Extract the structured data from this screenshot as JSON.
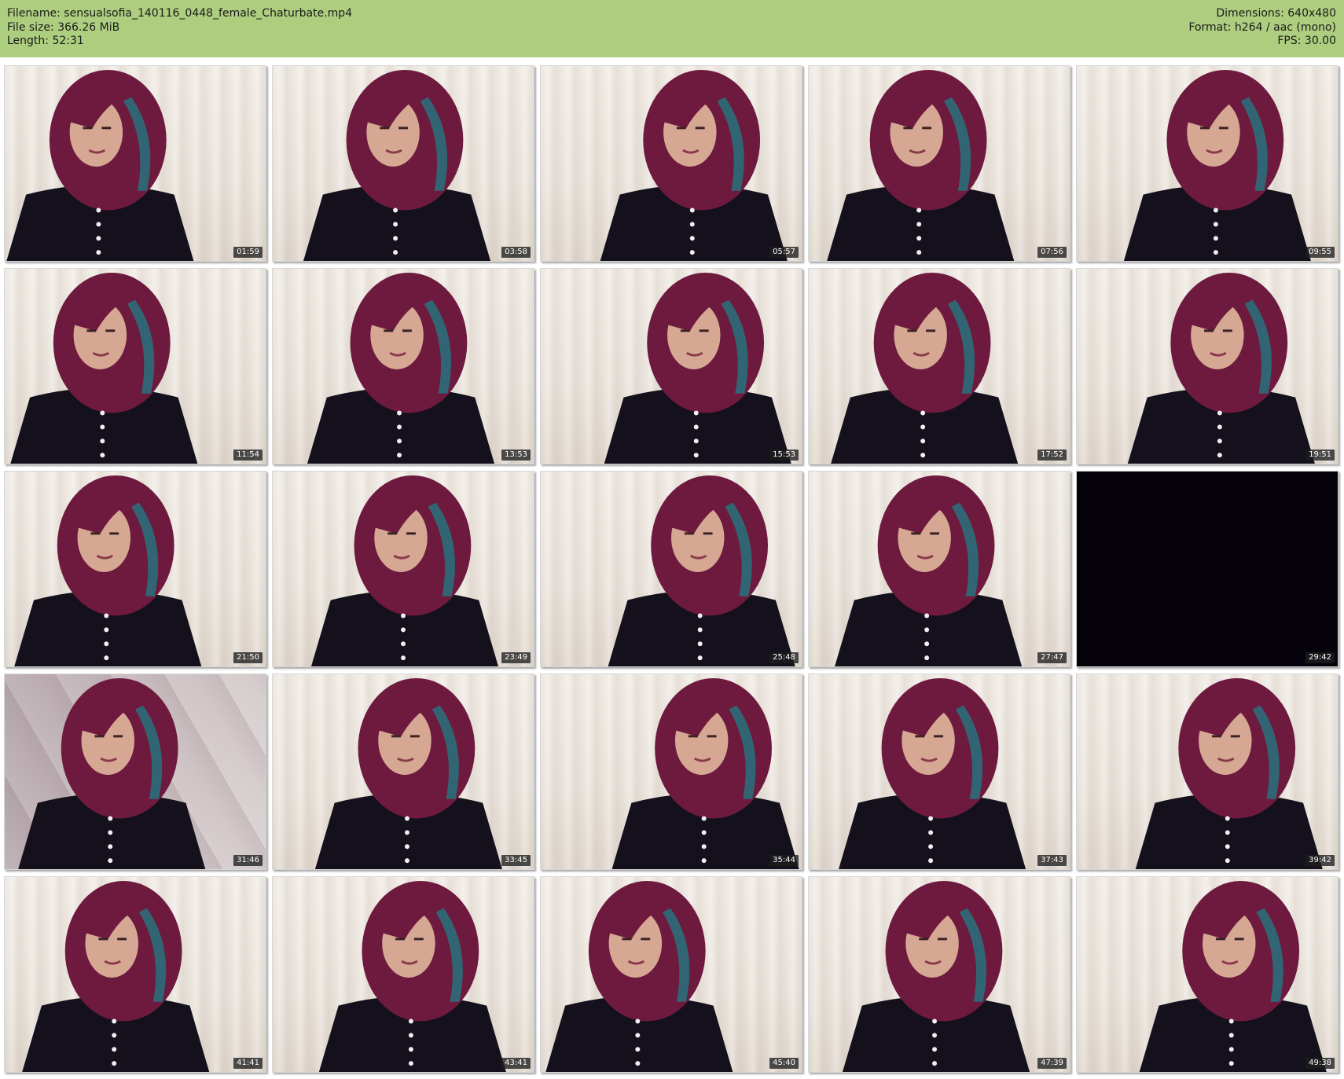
{
  "header": {
    "filename": "Filename: sensualsofia_140116_0448_female_Chaturbate.mp4",
    "filesize": "File size: 366.26 MiB",
    "length": "Length: 52:31",
    "dimensions": "Dimensions: 640x480",
    "format": "Format: h264 / aac (mono)",
    "fps": "FPS: 30.00",
    "bg_color": "#aece7f"
  },
  "thumbnails": [
    {
      "time": "01:59"
    },
    {
      "time": "03:58"
    },
    {
      "time": "05:57"
    },
    {
      "time": "07:56"
    },
    {
      "time": "09:55"
    },
    {
      "time": "11:54"
    },
    {
      "time": "13:53"
    },
    {
      "time": "15:53"
    },
    {
      "time": "17:52"
    },
    {
      "time": "19:51"
    },
    {
      "time": "21:50"
    },
    {
      "time": "23:49"
    },
    {
      "time": "25:48"
    },
    {
      "time": "27:47"
    },
    {
      "time": "29:42"
    },
    {
      "time": "31:46"
    },
    {
      "time": "33:45"
    },
    {
      "time": "35:44"
    },
    {
      "time": "37:43"
    },
    {
      "time": "39:42"
    },
    {
      "time": "41:41"
    },
    {
      "time": "43:41"
    },
    {
      "time": "45:40"
    },
    {
      "time": "47:39"
    },
    {
      "time": "49:38"
    }
  ],
  "colors": {
    "hair": "#6e1a3f",
    "hair_highlight": "#1f7f86",
    "jacket": "#15111c",
    "skin": "#d6a894"
  }
}
